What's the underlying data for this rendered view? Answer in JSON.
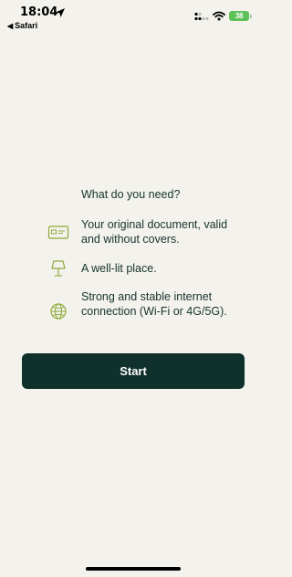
{
  "status_bar": {
    "time": "18:04",
    "back_app": "Safari",
    "battery": "38"
  },
  "main": {
    "heading": "What do you need?",
    "requirements": [
      {
        "icon": "id-card-icon",
        "text": "Your original document, valid and without covers."
      },
      {
        "icon": "lamp-icon",
        "text": "A well-lit place."
      },
      {
        "icon": "globe-icon",
        "text": "Strong and stable internet connection (Wi-Fi or 4G/5G)."
      }
    ],
    "start_label": "Start"
  },
  "colors": {
    "background": "#f3f2ed",
    "primary_button": "#0f302b",
    "text": "#17332e",
    "icon_accent": "#8fa93a"
  }
}
